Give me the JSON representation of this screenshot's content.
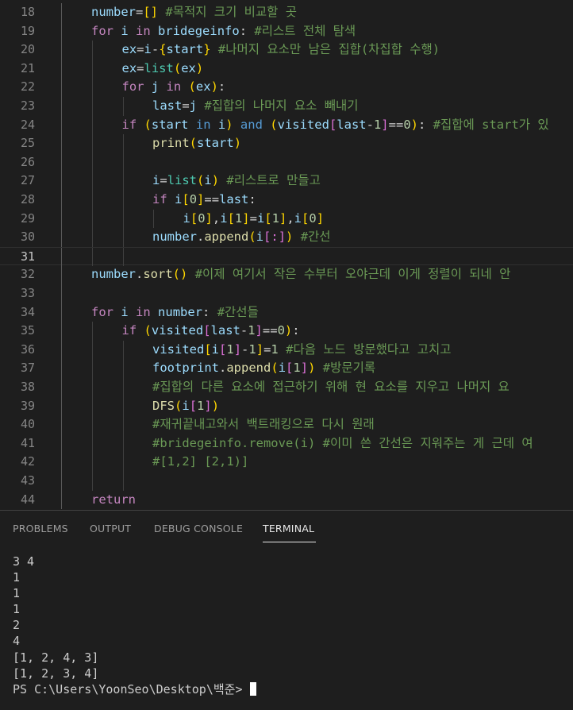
{
  "editor": {
    "active_line": "31",
    "lines": [
      {
        "n": "18",
        "indent": 0,
        "html": [
          [
            "var",
            "number"
          ],
          [
            "op",
            "="
          ],
          [
            "br1",
            "[]"
          ],
          [
            "op",
            " "
          ],
          [
            "cmt",
            "#목적지 크기 비교할 곳"
          ]
        ]
      },
      {
        "n": "19",
        "indent": 0,
        "html": [
          [
            "kw",
            "for"
          ],
          [
            "op",
            " "
          ],
          [
            "var",
            "i"
          ],
          [
            "op",
            " "
          ],
          [
            "kw",
            "in"
          ],
          [
            "op",
            " "
          ],
          [
            "var",
            "bridegeinfo"
          ],
          [
            "op",
            ": "
          ],
          [
            "cmt",
            "#리스트 전체 탐색"
          ]
        ]
      },
      {
        "n": "20",
        "indent": 1,
        "html": [
          [
            "var",
            "ex"
          ],
          [
            "op",
            "="
          ],
          [
            "var",
            "i"
          ],
          [
            "op",
            "-"
          ],
          [
            "br1",
            "{"
          ],
          [
            "var",
            "start"
          ],
          [
            "br1",
            "}"
          ],
          [
            "op",
            " "
          ],
          [
            "cmt",
            "#나머지 요소만 남은 집합(차집합 수행)"
          ]
        ]
      },
      {
        "n": "21",
        "indent": 1,
        "html": [
          [
            "var",
            "ex"
          ],
          [
            "op",
            "="
          ],
          [
            "class",
            "list"
          ],
          [
            "br1",
            "("
          ],
          [
            "var",
            "ex"
          ],
          [
            "br1",
            ")"
          ]
        ]
      },
      {
        "n": "22",
        "indent": 1,
        "html": [
          [
            "kw",
            "for"
          ],
          [
            "op",
            " "
          ],
          [
            "var",
            "j"
          ],
          [
            "op",
            " "
          ],
          [
            "kw",
            "in"
          ],
          [
            "op",
            " "
          ],
          [
            "br1",
            "("
          ],
          [
            "var",
            "ex"
          ],
          [
            "br1",
            ")"
          ],
          [
            "op",
            ":"
          ]
        ]
      },
      {
        "n": "23",
        "indent": 2,
        "html": [
          [
            "var",
            "last"
          ],
          [
            "op",
            "="
          ],
          [
            "var",
            "j"
          ],
          [
            "op",
            " "
          ],
          [
            "cmt",
            "#집합의 나머지 요소 빼내기"
          ]
        ]
      },
      {
        "n": "24",
        "indent": 1,
        "html": [
          [
            "kw",
            "if"
          ],
          [
            "op",
            " "
          ],
          [
            "br1",
            "("
          ],
          [
            "var",
            "start"
          ],
          [
            "op",
            " "
          ],
          [
            "op2",
            "in"
          ],
          [
            "op",
            " "
          ],
          [
            "var",
            "i"
          ],
          [
            "br1",
            ")"
          ],
          [
            "op",
            " "
          ],
          [
            "op2",
            "and"
          ],
          [
            "op",
            " "
          ],
          [
            "br1",
            "("
          ],
          [
            "var",
            "visited"
          ],
          [
            "br2",
            "["
          ],
          [
            "var",
            "last"
          ],
          [
            "op",
            "-"
          ],
          [
            "num",
            "1"
          ],
          [
            "br2",
            "]"
          ],
          [
            "op",
            "=="
          ],
          [
            "num",
            "0"
          ],
          [
            "br1",
            ")"
          ],
          [
            "op",
            ": "
          ],
          [
            "cmt",
            "#집합에 start가 있"
          ]
        ]
      },
      {
        "n": "25",
        "indent": 2,
        "html": [
          [
            "fn",
            "print"
          ],
          [
            "br1",
            "("
          ],
          [
            "var",
            "start"
          ],
          [
            "br1",
            ")"
          ]
        ]
      },
      {
        "n": "26",
        "indent": 2,
        "html": []
      },
      {
        "n": "27",
        "indent": 2,
        "html": [
          [
            "var",
            "i"
          ],
          [
            "op",
            "="
          ],
          [
            "class",
            "list"
          ],
          [
            "br1",
            "("
          ],
          [
            "var",
            "i"
          ],
          [
            "br1",
            ")"
          ],
          [
            "op",
            " "
          ],
          [
            "cmt",
            "#리스트로 만들고"
          ]
        ]
      },
      {
        "n": "28",
        "indent": 2,
        "html": [
          [
            "kw",
            "if"
          ],
          [
            "op",
            " "
          ],
          [
            "var",
            "i"
          ],
          [
            "br1",
            "["
          ],
          [
            "num",
            "0"
          ],
          [
            "br1",
            "]"
          ],
          [
            "op",
            "=="
          ],
          [
            "var",
            "last"
          ],
          [
            "op",
            ":"
          ]
        ]
      },
      {
        "n": "29",
        "indent": 3,
        "html": [
          [
            "var",
            "i"
          ],
          [
            "br1",
            "["
          ],
          [
            "num",
            "0"
          ],
          [
            "br1",
            "]"
          ],
          [
            "op",
            ","
          ],
          [
            "var",
            "i"
          ],
          [
            "br1",
            "["
          ],
          [
            "num",
            "1"
          ],
          [
            "br1",
            "]"
          ],
          [
            "op",
            "="
          ],
          [
            "var",
            "i"
          ],
          [
            "br1",
            "["
          ],
          [
            "num",
            "1"
          ],
          [
            "br1",
            "]"
          ],
          [
            "op",
            ","
          ],
          [
            "var",
            "i"
          ],
          [
            "br1",
            "["
          ],
          [
            "num",
            "0"
          ],
          [
            "br1",
            "]"
          ]
        ]
      },
      {
        "n": "30",
        "indent": 2,
        "html": [
          [
            "var",
            "number"
          ],
          [
            "op",
            "."
          ],
          [
            "fn",
            "append"
          ],
          [
            "br1",
            "("
          ],
          [
            "var",
            "i"
          ],
          [
            "br2",
            "[:]"
          ],
          [
            "br1",
            ")"
          ],
          [
            "op",
            " "
          ],
          [
            "cmt",
            "#간선"
          ]
        ]
      },
      {
        "n": "31",
        "indent": 0,
        "html": []
      },
      {
        "n": "32",
        "indent": 0,
        "html": [
          [
            "var",
            "number"
          ],
          [
            "op",
            "."
          ],
          [
            "fn",
            "sort"
          ],
          [
            "br1",
            "()"
          ],
          [
            "op",
            " "
          ],
          [
            "cmt",
            "#이제 여기서 작은 수부터 오야근데 이게 정렬이 되네 안"
          ]
        ]
      },
      {
        "n": "33",
        "indent": 0,
        "html": []
      },
      {
        "n": "34",
        "indent": 0,
        "html": [
          [
            "kw",
            "for"
          ],
          [
            "op",
            " "
          ],
          [
            "var",
            "i"
          ],
          [
            "op",
            " "
          ],
          [
            "kw",
            "in"
          ],
          [
            "op",
            " "
          ],
          [
            "var",
            "number"
          ],
          [
            "op",
            ": "
          ],
          [
            "cmt",
            "#간선들"
          ]
        ]
      },
      {
        "n": "35",
        "indent": 1,
        "html": [
          [
            "kw",
            "if"
          ],
          [
            "op",
            " "
          ],
          [
            "br1",
            "("
          ],
          [
            "var",
            "visited"
          ],
          [
            "br2",
            "["
          ],
          [
            "var",
            "last"
          ],
          [
            "op",
            "-"
          ],
          [
            "num",
            "1"
          ],
          [
            "br2",
            "]"
          ],
          [
            "op",
            "=="
          ],
          [
            "num",
            "0"
          ],
          [
            "br1",
            ")"
          ],
          [
            "op",
            ":"
          ]
        ]
      },
      {
        "n": "36",
        "indent": 2,
        "html": [
          [
            "var",
            "visited"
          ],
          [
            "br1",
            "["
          ],
          [
            "var",
            "i"
          ],
          [
            "br2",
            "["
          ],
          [
            "num",
            "1"
          ],
          [
            "br2",
            "]"
          ],
          [
            "op",
            "-"
          ],
          [
            "num",
            "1"
          ],
          [
            "br1",
            "]"
          ],
          [
            "op",
            "="
          ],
          [
            "num",
            "1"
          ],
          [
            "op",
            " "
          ],
          [
            "cmt",
            "#다음 노드 방문했다고 고치고"
          ]
        ]
      },
      {
        "n": "37",
        "indent": 2,
        "html": [
          [
            "var",
            "footprint"
          ],
          [
            "op",
            "."
          ],
          [
            "fn",
            "append"
          ],
          [
            "br1",
            "("
          ],
          [
            "var",
            "i"
          ],
          [
            "br2",
            "["
          ],
          [
            "num",
            "1"
          ],
          [
            "br2",
            "]"
          ],
          [
            "br1",
            ")"
          ],
          [
            "op",
            " "
          ],
          [
            "cmt",
            "#방문기록"
          ]
        ]
      },
      {
        "n": "38",
        "indent": 2,
        "html": [
          [
            "cmt",
            "#집합의 다른 요소에 접근하기 위해 현 요소를 지우고 나머지 요"
          ]
        ]
      },
      {
        "n": "39",
        "indent": 2,
        "html": [
          [
            "fn",
            "DFS"
          ],
          [
            "br1",
            "("
          ],
          [
            "var",
            "i"
          ],
          [
            "br2",
            "["
          ],
          [
            "num",
            "1"
          ],
          [
            "br2",
            "]"
          ],
          [
            "br1",
            ")"
          ]
        ]
      },
      {
        "n": "40",
        "indent": 2,
        "html": [
          [
            "cmt",
            "#재귀끝내고와서 백트래킹으로 다시 원래"
          ]
        ]
      },
      {
        "n": "41",
        "indent": 2,
        "html": [
          [
            "cmt",
            "#bridegeinfo.remove(i) #이미 쓴 간선은 지워주는 게 근데 여"
          ]
        ]
      },
      {
        "n": "42",
        "indent": 2,
        "html": [
          [
            "cmt",
            "#[1,2] [2,1)]"
          ]
        ]
      },
      {
        "n": "43",
        "indent": 0,
        "html": []
      },
      {
        "n": "44",
        "indent": 0,
        "html": [
          [
            "kw",
            "return"
          ]
        ]
      }
    ]
  },
  "panel": {
    "tabs": [
      {
        "label": "PROBLEMS"
      },
      {
        "label": "OUTPUT"
      },
      {
        "label": "DEBUG CONSOLE"
      },
      {
        "label": "TERMINAL"
      }
    ],
    "active_tab": "TERMINAL",
    "terminal_lines": [
      "3 4",
      "1",
      "1",
      "1",
      "2",
      "4",
      "[1, 2, 4, 3]",
      "[1, 2, 3, 4]"
    ],
    "prompt": "PS C:\\Users\\YoonSeo\\Desktop\\백준>"
  }
}
